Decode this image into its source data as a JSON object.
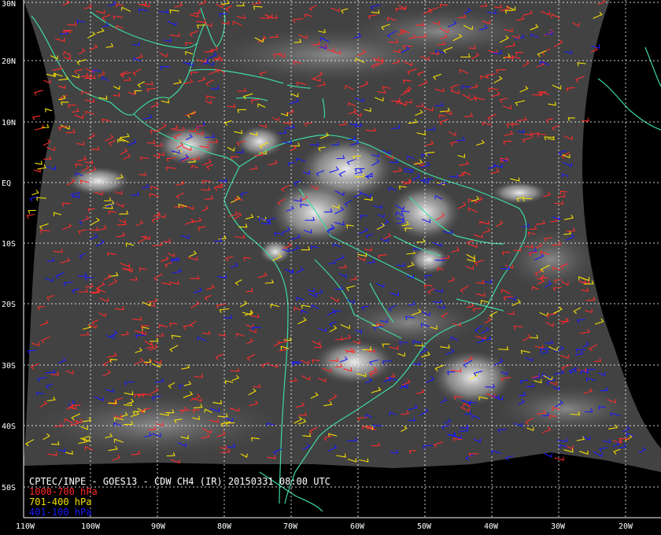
{
  "caption": {
    "title": "CPTEC/INPE - GOES13 - CDW CH4 (IR) 20150331 08:00 UTC",
    "legend": [
      {
        "label": "1000-700 hPa",
        "color": "#ff2a2a"
      },
      {
        "label": "701-400 hPa",
        "color": "#f5e000"
      },
      {
        "label": "401-100 hPa",
        "color": "#1a1aff"
      }
    ]
  },
  "latitude_labels": [
    "30N",
    "20N",
    "10N",
    "EQ",
    "10S",
    "20S",
    "30S",
    "40S",
    "50S"
  ],
  "longitude_labels": [
    "110W",
    "100W",
    "90W",
    "80W",
    "70W",
    "60W",
    "50W",
    "40W",
    "30W",
    "20W"
  ],
  "colors": {
    "coastline": "#3ed9a0",
    "graticule": "#ffffff",
    "background": "#000000",
    "wind_low": "#ff2a2a",
    "wind_mid": "#f5e000",
    "wind_high": "#1a1aff"
  }
}
